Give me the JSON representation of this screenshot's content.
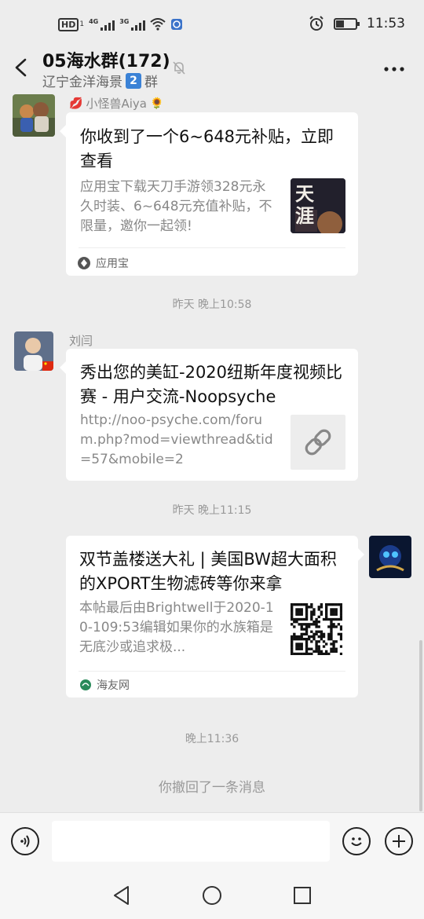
{
  "status_bar": {
    "hd": "HD",
    "hd_sub": "1",
    "net1": "4G",
    "net2": "3G",
    "time": "11:53",
    "battery_level": 0.4
  },
  "header": {
    "title": "05海水群(172)",
    "subtitle": "辽宁金洋海景",
    "subtitle_badge": "2",
    "subtitle_suffix": "群"
  },
  "messages": [
    {
      "sender": "小怪兽Aiya",
      "title": "你收到了一个6~648元补贴，立即查看",
      "desc": "应用宝下载天刀手游领328元永久时装、6~648元充值补贴，不限量，邀你一起领!",
      "thumb_text": "天涯",
      "source": "应用宝"
    },
    {
      "timestamp": "昨天 晚上10:58"
    },
    {
      "sender": "刘闫",
      "title": "秀出您的美缸-2020纽斯年度视频比赛 - 用户交流-Noopsyche",
      "desc": "http://noo-psyche.com/forum.php?mod=viewthread&tid=57&mobile=2"
    },
    {
      "timestamp": "昨天 晚上11:15"
    },
    {
      "title": "双节盖楼送大礼 | 美国BW超大面积的XPORT生物滤砖等你来拿",
      "desc": "本帖最后由Brightwell于2020-10-109:53编辑如果你的水族箱是无底沙或追求极...",
      "source": "海友网"
    },
    {
      "timestamp": "晚上11:36"
    },
    {
      "system": "你撤回了一条消息"
    }
  ],
  "input": {
    "placeholder": ""
  }
}
